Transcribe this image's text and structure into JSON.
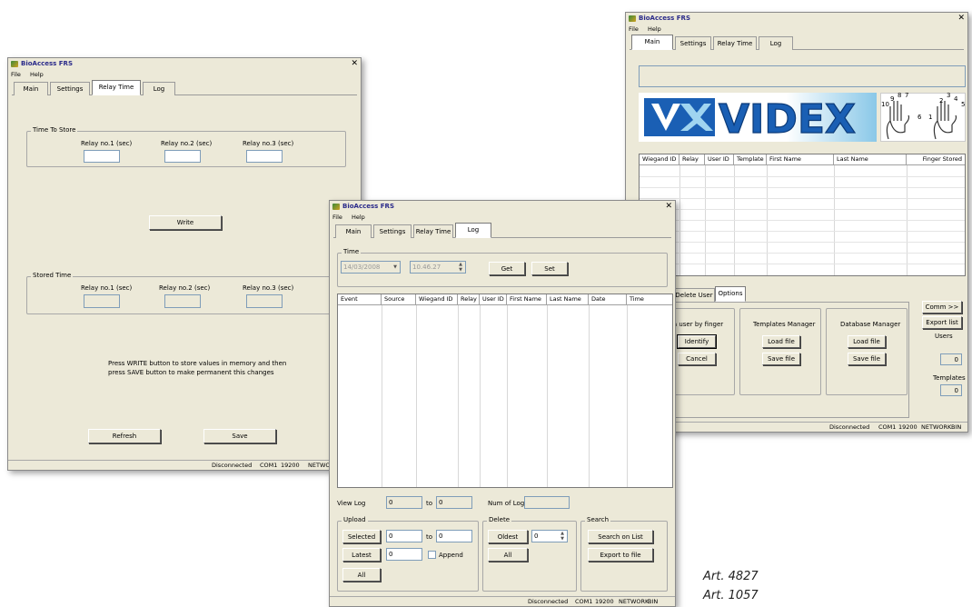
{
  "app_title": "BioAccess FRS",
  "menu": [
    "File",
    "Help"
  ],
  "tabs": [
    "Main",
    "Settings",
    "Relay Time",
    "Log"
  ],
  "relay_window": {
    "time_to_store_legend": "Time To Store",
    "stored_time_legend": "Stored Time",
    "relay_labels": [
      "Relay no.1 (sec)",
      "Relay no.2 (sec)",
      "Relay no.3 (sec)"
    ],
    "write_label": "Write",
    "info_line1": "Press WRITE button to store values in memory and then",
    "info_line2": "press SAVE button to make permanent this changes",
    "refresh_label": "Refresh",
    "save_label": "Save"
  },
  "log_window": {
    "time_legend": "Time",
    "date_value": "14/03/2008",
    "time_value": "10.46.27",
    "get_label": "Get",
    "set_label": "Set",
    "columns": [
      "Event",
      "Source",
      "Wiegand ID",
      "Relay",
      "User ID",
      "First Name",
      "Last Name",
      "Date",
      "Time"
    ],
    "view_log_label": "View Log",
    "view_from": "0",
    "to_label": "to",
    "view_to": "0",
    "num_of_log_label": "Num of Log",
    "upload_legend": "Upload",
    "selected_label": "Selected",
    "selected_from": "0",
    "selected_to": "0",
    "latest_label": "Latest",
    "latest_value": "0",
    "append_label": "Append",
    "all_label": "All",
    "delete_legend": "Delete",
    "oldest_label": "Oldest",
    "oldest_value": "0",
    "delete_all_label": "All",
    "search_legend": "Search",
    "search_on_list_label": "Search on List",
    "export_to_file_label": "Export to file"
  },
  "main_window": {
    "logo_text": "VIDEX",
    "finger_numbers": [
      "10",
      "9",
      "8",
      "7",
      "6",
      "1",
      "2",
      "3",
      "4",
      "5"
    ],
    "columns": [
      "Wiegand ID",
      "Relay",
      "User ID",
      "Template",
      "First Name",
      "Last Name",
      "Finger Stored"
    ],
    "sub_tabs": [
      "Delete User",
      "Options"
    ],
    "identify_text": "ntify a user by finger",
    "identify_label": "Identify",
    "cancel_label": "Cancel",
    "templates_manager_label": "Templates Manager",
    "load_file_label": "Load file",
    "save_file_label": "Save file",
    "database_manager_label": "Database Manager",
    "db_load_file_label": "Load file",
    "db_save_file_label": "Save file",
    "comm_label": "Comm >>",
    "export_list_label": "Export list",
    "users_label": "Users",
    "users_value": "0",
    "templates_label": "Templates",
    "templates_value": "0"
  },
  "status": {
    "connection": "Disconnected",
    "port": "COM1",
    "baud": "19200",
    "mode": "NETWORK",
    "format": "BIN",
    "mode_truncated": "NETWOR"
  },
  "captions": [
    "Art. 4827",
    "Art. 1057"
  ],
  "colors": {
    "window_bg": "#ece9d8",
    "logo_blue": "#1a5fb4",
    "logo_light": "#5ab0e0"
  }
}
